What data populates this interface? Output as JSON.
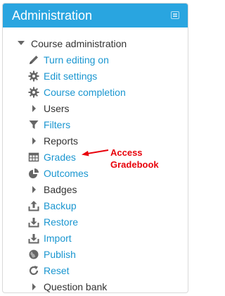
{
  "block": {
    "title": "Administration",
    "dock_icon": "dock-icon"
  },
  "tree": {
    "root_label": "Course administration",
    "items": [
      {
        "label": "Turn editing on",
        "icon": "pencil-icon",
        "kind": "link"
      },
      {
        "label": "Edit settings",
        "icon": "gear-icon",
        "kind": "link"
      },
      {
        "label": "Course completion",
        "icon": "gear-icon",
        "kind": "link"
      },
      {
        "label": "Users",
        "icon": "caret-right-icon",
        "kind": "branch"
      },
      {
        "label": "Filters",
        "icon": "filter-icon",
        "kind": "link"
      },
      {
        "label": "Reports",
        "icon": "caret-right-icon",
        "kind": "branch"
      },
      {
        "label": "Grades",
        "icon": "table-icon",
        "kind": "link"
      },
      {
        "label": "Outcomes",
        "icon": "pie-chart-icon",
        "kind": "link"
      },
      {
        "label": "Badges",
        "icon": "caret-right-icon",
        "kind": "branch"
      },
      {
        "label": "Backup",
        "icon": "upload-icon",
        "kind": "link"
      },
      {
        "label": "Restore",
        "icon": "download-icon",
        "kind": "link"
      },
      {
        "label": "Import",
        "icon": "import-icon",
        "kind": "link"
      },
      {
        "label": "Publish",
        "icon": "globe-icon",
        "kind": "link"
      },
      {
        "label": "Reset",
        "icon": "refresh-icon",
        "kind": "link"
      },
      {
        "label": "Question bank",
        "icon": "caret-right-icon",
        "kind": "branch"
      }
    ]
  },
  "annotation": {
    "line1": "Access",
    "line2": "Gradebook",
    "color": "#e8000a"
  },
  "colors": {
    "header": "#29a5e0",
    "link": "#1a96d0",
    "text": "#333333"
  }
}
